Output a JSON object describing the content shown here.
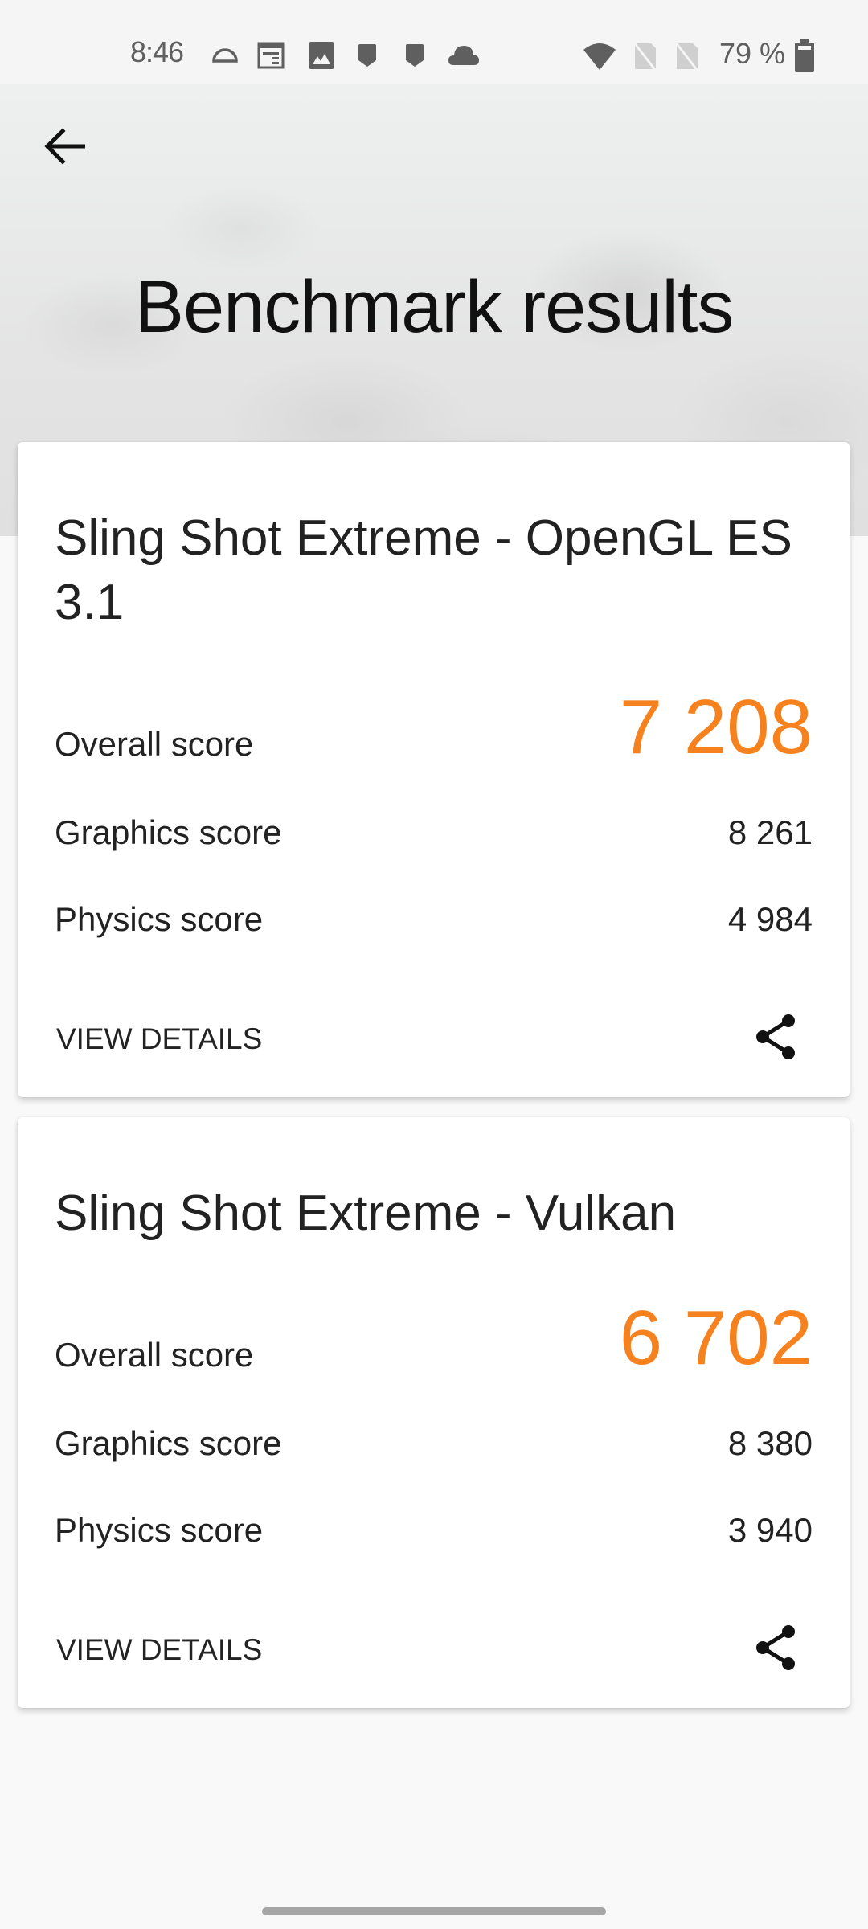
{
  "status_bar": {
    "time": "8:46",
    "left_icons": [
      "headset-icon",
      "calendar-icon",
      "image-icon",
      "notification-badge-icon",
      "notification-badge-icon",
      "cloud-icon"
    ],
    "right_icons": [
      "wifi-icon",
      "sim-off-icon",
      "sim-off-icon"
    ],
    "battery_percent": "79 %",
    "battery_icon": "battery-icon"
  },
  "header": {
    "back_icon": "arrow-back-icon",
    "title": "Benchmark results"
  },
  "accent_color": "#f5821f",
  "results": [
    {
      "title": "Sling Shot Extreme - OpenGL ES 3.1",
      "overall_label": "Overall score",
      "overall_value": "7 208",
      "graphics_label": "Graphics score",
      "graphics_value": "8 261",
      "physics_label": "Physics score",
      "physics_value": "4 984",
      "view_details_label": "VIEW DETAILS",
      "share_icon": "share-icon"
    },
    {
      "title": "Sling Shot Extreme - Vulkan",
      "overall_label": "Overall score",
      "overall_value": "6 702",
      "graphics_label": "Graphics score",
      "graphics_value": "8 380",
      "physics_label": "Physics score",
      "physics_value": "3 940",
      "view_details_label": "VIEW DETAILS",
      "share_icon": "share-icon"
    }
  ]
}
